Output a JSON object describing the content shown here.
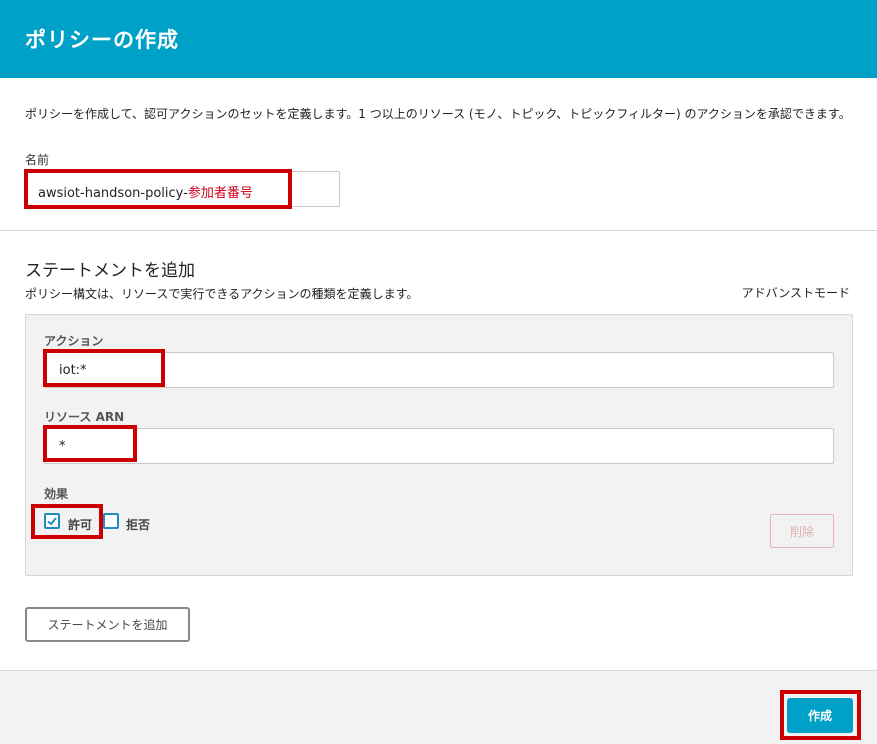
{
  "header": {
    "title": "ポリシーの作成"
  },
  "form": {
    "description": "ポリシーを作成して、認可アクションのセットを定義します。1 つ以上のリソース (モノ、トピック、トピックフィルター) のアクションを承認できます。",
    "name_label": "名前",
    "name_value": "awsiot-handson-policy-",
    "name_suffix_annotation": "参加者番号"
  },
  "statement_section": {
    "title": "ステートメントを追加",
    "description": "ポリシー構文は、リソースで実行できるアクションの種類を定義します。",
    "advanced_mode": "アドバンストモード"
  },
  "statement": {
    "action_label": "アクション",
    "action_value": "iot:*",
    "resource_label": "リソース ARN",
    "resource_value": "*",
    "effect_label": "効果",
    "allow_label": "許可",
    "allow_checked": true,
    "deny_label": "拒否",
    "deny_checked": false,
    "delete_label": "削除"
  },
  "buttons": {
    "add_statement": "ステートメントを追加",
    "create": "作成"
  },
  "colors": {
    "header_bg": "#00a1c9",
    "primary_button": "#00a1c9",
    "annotation_red": "#cc0000",
    "checkbox_blue": "#1d8dbd"
  }
}
